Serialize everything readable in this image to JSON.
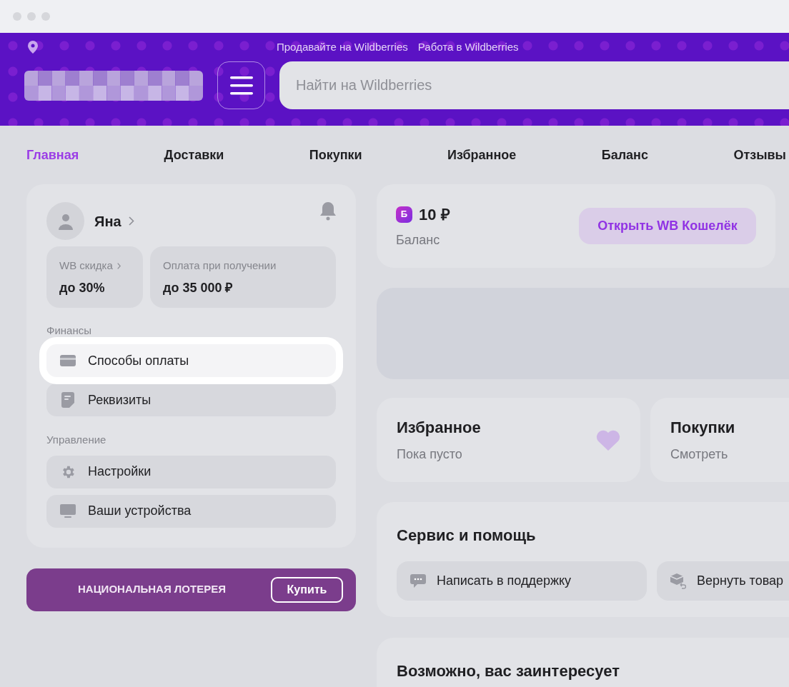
{
  "header": {
    "links": [
      "Продавайте на Wildberries",
      "Работа в Wildberries"
    ],
    "search": {
      "placeholder": "Найти на Wildberries"
    }
  },
  "nav": [
    {
      "label": "Главная",
      "selected": true
    },
    {
      "label": "Доставки",
      "selected": false
    },
    {
      "label": "Покупки",
      "selected": false
    },
    {
      "label": "Избранное",
      "selected": false
    },
    {
      "label": "Баланс",
      "selected": false
    },
    {
      "label": "Отзывы",
      "selected": false
    }
  ],
  "profile": {
    "name": "Яна",
    "stats": [
      {
        "label": "WB скидка",
        "value": "до 30%",
        "arrow": true
      },
      {
        "label": "Оплата при получении",
        "value": "до 35 000 ₽",
        "arrow": false
      }
    ],
    "sections": [
      {
        "title": "Финансы",
        "items": [
          {
            "label": "Способы оплаты",
            "kind": "card",
            "selected": true
          },
          {
            "label": "Реквизиты",
            "kind": "document",
            "selected": false
          }
        ]
      },
      {
        "title": "Управление",
        "items": [
          {
            "label": "Настройки",
            "kind": "gear",
            "selected": false
          },
          {
            "label": "Ваши устройства",
            "kind": "monitor",
            "selected": false
          }
        ]
      }
    ]
  },
  "lottery": {
    "title": "НАЦИОНАЛЬНАЯ ЛОТЕРЕЯ",
    "button": "Купить"
  },
  "balance": {
    "badge": "Б",
    "amount": "10 ₽",
    "label": "Баланс",
    "button": "Открыть WB Кошелёк"
  },
  "tiles": [
    {
      "title": "Избранное",
      "subtitle": "Пока пусто",
      "kind": "heart"
    },
    {
      "title": "Покупки",
      "subtitle": "Смотреть",
      "kind": "plain"
    }
  ],
  "service": {
    "title": "Сервис и помощь",
    "actions": [
      {
        "label": "Написать в поддержку",
        "kind": "chat"
      },
      {
        "label": "Вернуть товар",
        "kind": "box"
      }
    ]
  },
  "suggestions": {
    "title": "Возможно, вас заинтересует"
  }
}
